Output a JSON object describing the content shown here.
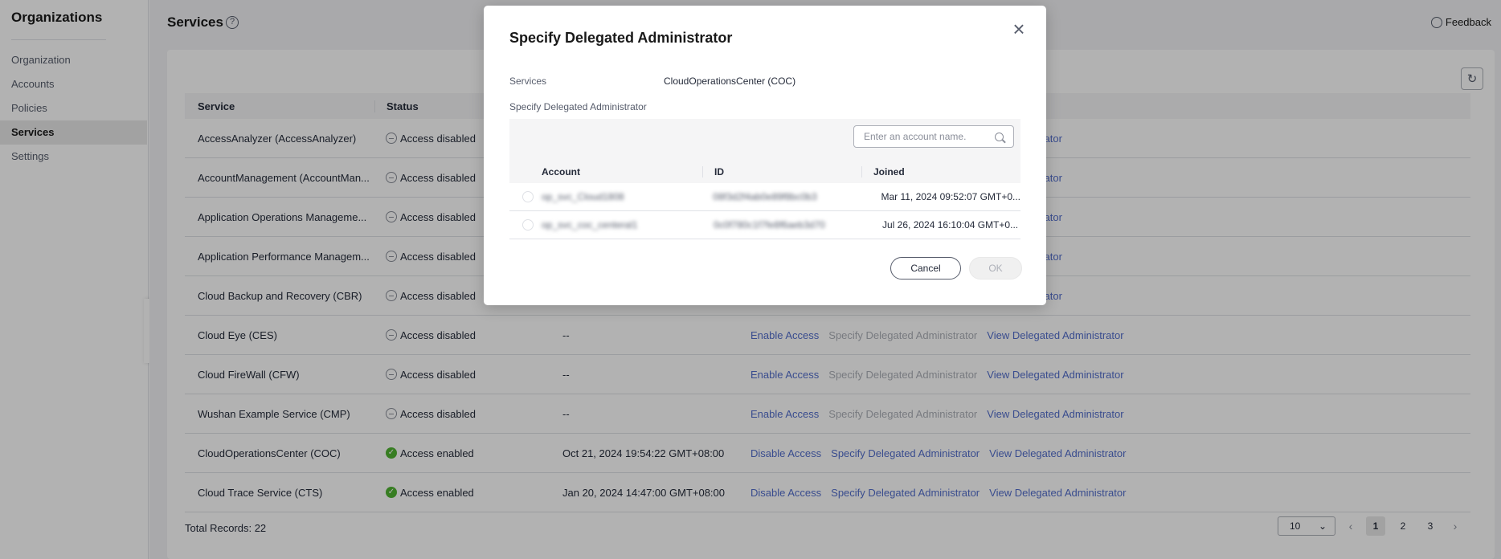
{
  "sidebar": {
    "title": "Organizations",
    "items": [
      {
        "label": "Organization"
      },
      {
        "label": "Accounts"
      },
      {
        "label": "Policies"
      },
      {
        "label": "Services"
      },
      {
        "label": "Settings"
      }
    ],
    "active_index": 3
  },
  "header": {
    "title": "Services",
    "help_glyph": "?",
    "feedback_label": "Feedback"
  },
  "table": {
    "columns": [
      "Service",
      "Status"
    ],
    "rows": [
      {
        "service": "AccessAnalyzer (AccessAnalyzer)",
        "status": "Access disabled",
        "enabled": false,
        "date": "",
        "actions": [
          "",
          "",
          "ed Administrator"
        ]
      },
      {
        "service": "AccountManagement (AccountMan...",
        "status": "Access disabled",
        "enabled": false,
        "date": "",
        "actions": [
          "",
          "",
          "ed Administrator"
        ]
      },
      {
        "service": "Application Operations Manageme...",
        "status": "Access disabled",
        "enabled": false,
        "date": "",
        "actions": [
          "",
          "",
          "ed Administrator"
        ]
      },
      {
        "service": "Application Performance Managem...",
        "status": "Access disabled",
        "enabled": false,
        "date": "",
        "actions": [
          "",
          "",
          "ed Administrator"
        ]
      },
      {
        "service": "Cloud Backup and Recovery (CBR)",
        "status": "Access disabled",
        "enabled": false,
        "date": "",
        "actions": [
          "",
          "",
          "ed Administrator"
        ]
      },
      {
        "service": "Cloud Eye (CES)",
        "status": "Access disabled",
        "enabled": false,
        "date": "--",
        "actions": [
          "Enable Access",
          "Specify Delegated Administrator",
          "View Delegated Administrator"
        ]
      },
      {
        "service": "Cloud FireWall (CFW)",
        "status": "Access disabled",
        "enabled": false,
        "date": "--",
        "actions": [
          "Enable Access",
          "Specify Delegated Administrator",
          "View Delegated Administrator"
        ]
      },
      {
        "service": "Wushan Example Service (CMP)",
        "status": "Access disabled",
        "enabled": false,
        "date": "--",
        "actions": [
          "Enable Access",
          "Specify Delegated Administrator",
          "View Delegated Administrator"
        ]
      },
      {
        "service": "CloudOperationsCenter (COC)",
        "status": "Access enabled",
        "enabled": true,
        "date": "Oct 21, 2024 19:54:22 GMT+08:00",
        "actions": [
          "Disable Access",
          "Specify Delegated Administrator",
          "View Delegated Administrator"
        ]
      },
      {
        "service": "Cloud Trace Service (CTS)",
        "status": "Access enabled",
        "enabled": true,
        "date": "Jan 20, 2024 14:47:00 GMT+08:00",
        "actions": [
          "Disable Access",
          "Specify Delegated Administrator",
          "View Delegated Administrator"
        ]
      }
    ]
  },
  "footer": {
    "total": "Total Records: 22",
    "page_size": "10",
    "pages": [
      "1",
      "2",
      "3"
    ],
    "current_page": "1"
  },
  "modal": {
    "title": "Specify Delegated Administrator",
    "services_label": "Services",
    "services_value": "CloudOperationsCenter (COC)",
    "section_label": "Specify Delegated Administrator",
    "search_placeholder": "Enter an account name.",
    "columns": [
      "Account",
      "ID",
      "Joined"
    ],
    "rows": [
      {
        "account": "op_svc_Cloud1808",
        "id": "08f3d2f4ab0e89f8bc0b3",
        "joined": "Mar 11, 2024 09:52:07 GMT+0..."
      },
      {
        "account": "op_svc_coc_centeral1",
        "id": "0c0f780c1f7fe8f6aeb3d70",
        "joined": "Jul 26, 2024 16:10:04 GMT+0..."
      }
    ],
    "cancel_label": "Cancel",
    "ok_label": "OK"
  },
  "icons": {
    "close": "×",
    "collapse": "‹",
    "refresh": "↻",
    "chevron_down": "⌄",
    "prev": "‹",
    "next": "›",
    "check": "✓"
  },
  "colors": {
    "link": "#526ecc",
    "enabled": "#50b432",
    "overlay": "rgba(0,0,0,0.30)"
  }
}
